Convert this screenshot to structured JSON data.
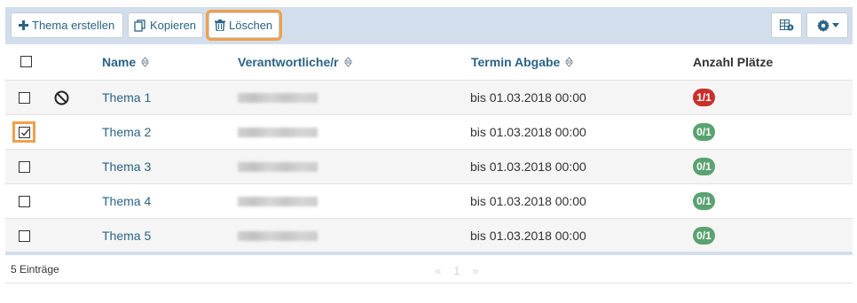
{
  "toolbar": {
    "create_label": "Thema erstellen",
    "copy_label": "Kopieren",
    "delete_label": "Löschen"
  },
  "columns": {
    "name": "Name",
    "responsible": "Verantwortliche/r",
    "deadline": "Termin Abgabe",
    "places": "Anzahl Plätze"
  },
  "rows": [
    {
      "name": "Thema 1",
      "deadline": "bis 01.03.2018 00:00",
      "places": "1/1",
      "places_color": "#c9302c",
      "checked": false,
      "blocked": true
    },
    {
      "name": "Thema 2",
      "deadline": "bis 01.03.2018 00:00",
      "places": "0/1",
      "places_color": "#5aa271",
      "checked": true,
      "blocked": false
    },
    {
      "name": "Thema 3",
      "deadline": "bis 01.03.2018 00:00",
      "places": "0/1",
      "places_color": "#5aa271",
      "checked": false,
      "blocked": false
    },
    {
      "name": "Thema 4",
      "deadline": "bis 01.03.2018 00:00",
      "places": "0/1",
      "places_color": "#5aa271",
      "checked": false,
      "blocked": false
    },
    {
      "name": "Thema 5",
      "deadline": "bis 01.03.2018 00:00",
      "places": "0/1",
      "places_color": "#5aa271",
      "checked": false,
      "blocked": false
    }
  ],
  "footer": {
    "count_text": "5 Einträge",
    "prev": "«",
    "page": "1",
    "next": "»"
  },
  "colors": {
    "accent": "#2a6486",
    "highlight": "#f0a04b",
    "toolbar_bg": "#d2deeb"
  }
}
